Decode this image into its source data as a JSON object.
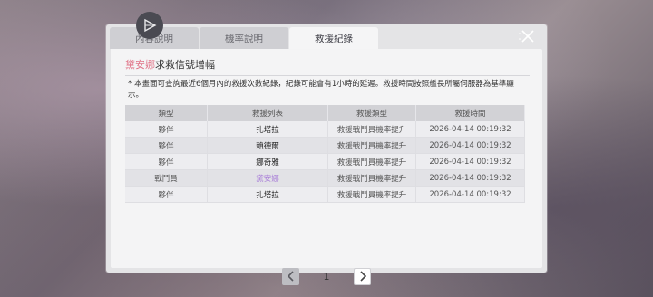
{
  "tabs": [
    {
      "label": "內容說明",
      "active": false
    },
    {
      "label": "機率說明",
      "active": false
    },
    {
      "label": "救援紀錄",
      "active": true
    }
  ],
  "panel": {
    "title_name": "黛安娜",
    "title_rest": "求救信號增幅",
    "note": "* 本畫面可查詢最近6個月內的救援次數紀錄，紀錄可能會有1小時的延遲。救援時間按照艦長所屬伺服器為基準顯示。"
  },
  "table": {
    "headers": [
      "類型",
      "救援列表",
      "救援類型",
      "救援時間"
    ],
    "rows": [
      {
        "type": "夥伴",
        "name": "扎塔拉",
        "rescue_type": "救援戰鬥員機率提升",
        "time": "2026-04-14 00:19:32",
        "highlight": false
      },
      {
        "type": "夥伴",
        "name": "賴德爾",
        "rescue_type": "救援戰鬥員機率提升",
        "time": "2026-04-14 00:19:32",
        "highlight": false
      },
      {
        "type": "夥伴",
        "name": "娜奇雅",
        "rescue_type": "救援戰鬥員機率提升",
        "time": "2026-04-14 00:19:32",
        "highlight": false
      },
      {
        "type": "戰鬥員",
        "name": "黛安娜",
        "rescue_type": "救援戰鬥員機率提升",
        "time": "2026-04-14 00:19:32",
        "highlight": true
      },
      {
        "type": "夥伴",
        "name": "扎塔拉",
        "rescue_type": "救援戰鬥員機率提升",
        "time": "2026-04-14 00:19:32",
        "highlight": false
      }
    ]
  },
  "pagination": {
    "current": "1"
  },
  "icons": {
    "close": "close-x-icon",
    "corner": "play-triangle-icon",
    "prev": "chevron-left-icon",
    "next": "chevron-right-icon"
  },
  "colors": {
    "accent_name": "#e07488",
    "highlight_name": "#a97ed8"
  }
}
